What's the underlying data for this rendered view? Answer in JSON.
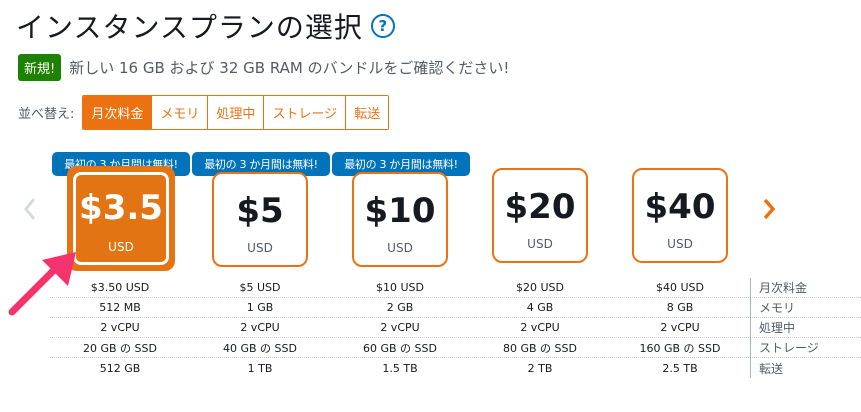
{
  "header": {
    "title": "インスタンスプランの選択",
    "help_icon": "?"
  },
  "notice": {
    "badge": "新規!",
    "text": "新しい 16 GB および 32 GB RAM のバンドルをご確認ください!"
  },
  "sort": {
    "label": "並べ替え:",
    "options": [
      "月次料金",
      "メモリ",
      "処理中",
      "ストレージ",
      "転送"
    ],
    "active": "月次料金"
  },
  "colors": {
    "accent": "#ec7211",
    "info": "#0073bb",
    "new_badge": "#1d8102",
    "arrow": "#f4336d"
  },
  "free_label": "最初の 3 か月間は無料!",
  "plans": [
    {
      "price": "$3.5",
      "currency": "USD",
      "free": true,
      "selected": true
    },
    {
      "price": "$5",
      "currency": "USD",
      "free": true,
      "selected": false
    },
    {
      "price": "$10",
      "currency": "USD",
      "free": true,
      "selected": false
    },
    {
      "price": "$20",
      "currency": "USD",
      "free": false,
      "selected": false
    },
    {
      "price": "$40",
      "currency": "USD",
      "free": false,
      "selected": false
    }
  ],
  "specs": {
    "labels": [
      "月次料金",
      "メモリ",
      "処理中",
      "ストレージ",
      "転送"
    ],
    "rows": [
      [
        "$3.50 USD",
        "$5 USD",
        "$10 USD",
        "$20 USD",
        "$40 USD"
      ],
      [
        "512 MB",
        "1 GB",
        "2 GB",
        "4 GB",
        "8 GB"
      ],
      [
        "2 vCPU",
        "2 vCPU",
        "2 vCPU",
        "2 vCPU",
        "2 vCPU"
      ],
      [
        "20 GB の SSD",
        "40 GB の SSD",
        "60 GB の SSD",
        "80 GB の SSD",
        "160 GB の SSD"
      ],
      [
        "512 GB",
        "1 TB",
        "1.5 TB",
        "2 TB",
        "2.5 TB"
      ]
    ]
  }
}
